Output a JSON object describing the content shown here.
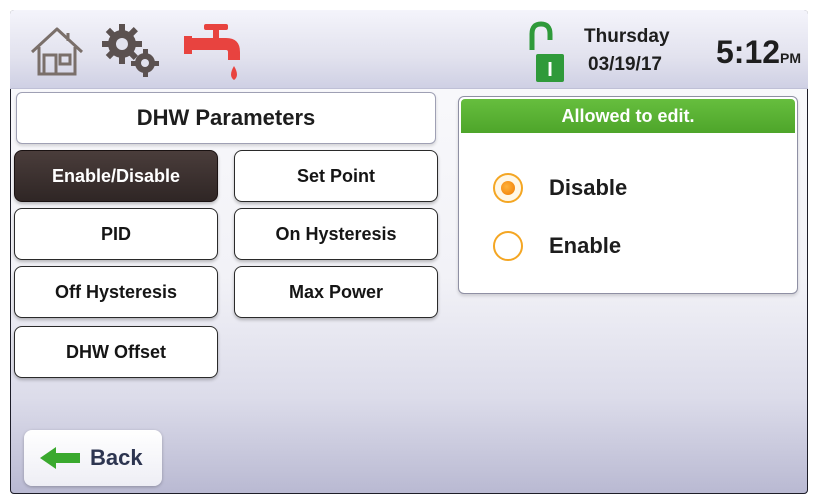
{
  "header": {
    "day": "Thursday",
    "date": "03/19/17",
    "time": "5:12",
    "ampm": "PM",
    "lock_status_letter": "I"
  },
  "icons": {
    "home": "home-icon",
    "settings": "gear-icon",
    "hot_water": "faucet-icon",
    "lock": "lock-icon"
  },
  "page_title": "DHW Parameters",
  "buttons": {
    "enable_disable": "Enable/Disable",
    "set_point": "Set Point",
    "pid": "PID",
    "on_hysteresis": "On Hysteresis",
    "off_hysteresis": "Off Hysteresis",
    "max_power": "Max Power",
    "dhw_offset": "DHW Offset"
  },
  "active_button": "Enable/Disable",
  "panel": {
    "header": "Allowed to edit.",
    "options": [
      "Disable",
      "Enable"
    ],
    "selected": "Disable"
  },
  "back_label": "Back",
  "colors": {
    "accent_green": "#56ad2f",
    "radio_orange": "#f4a623",
    "faucet_red": "#e8433f",
    "active_button": "#3a2f2d"
  }
}
